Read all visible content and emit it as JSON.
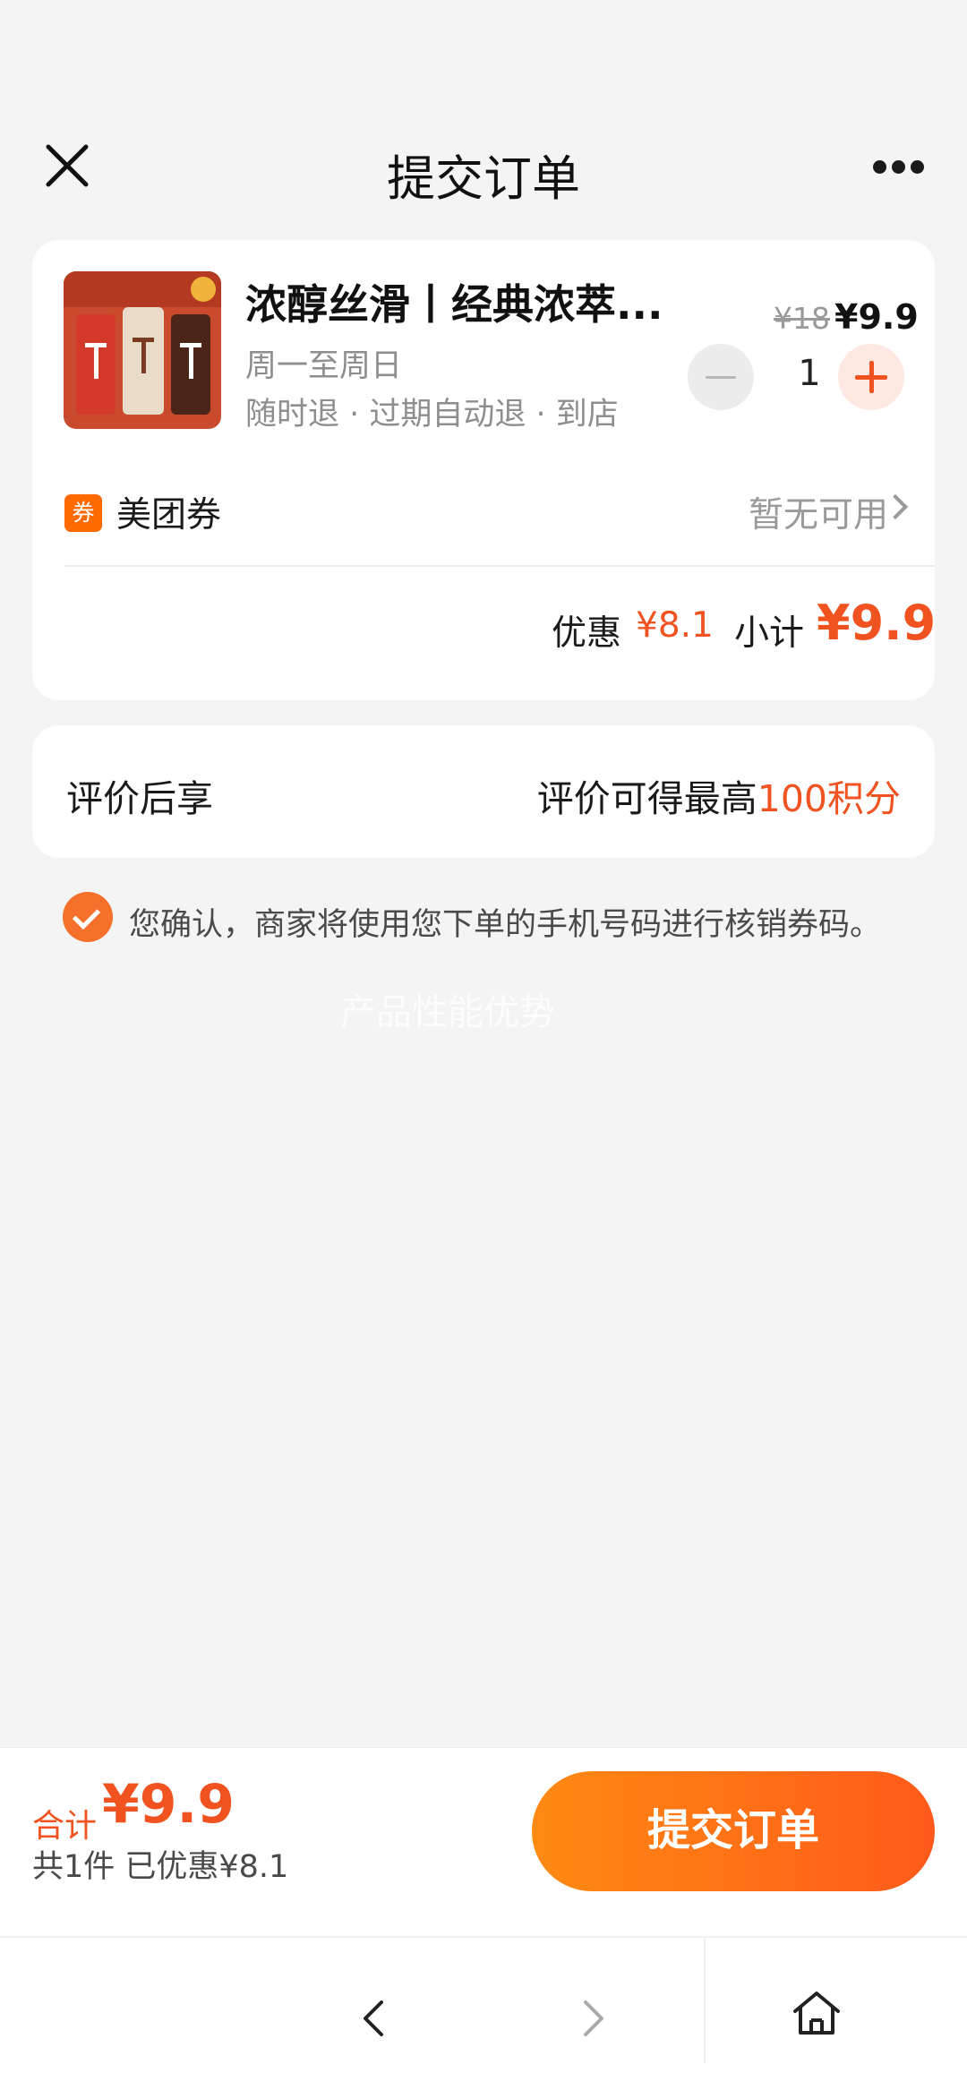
{
  "header": {
    "title": "提交订单"
  },
  "product": {
    "title": "浓醇丝滑丨经典浓萃...",
    "days": "周一至周日",
    "policy": "随时退 · 过期自动退 · 到店",
    "original_price": "¥18",
    "price": "¥9.9",
    "quantity": "1"
  },
  "coupon": {
    "icon_label": "券",
    "label": "美团券",
    "status": "暂无可用"
  },
  "summary": {
    "discount_label": "优惠",
    "discount_value": "¥8.1",
    "subtotal_label": "小计",
    "subtotal_value": "¥9.9"
  },
  "review": {
    "label": "评价后享",
    "note_prefix": "评价可得最高",
    "note_highlight": "100积分"
  },
  "confirm": {
    "text": "您确认，商家将使用您下单的手机号码进行核销券码。"
  },
  "watermark": "产品性能优势",
  "footer": {
    "total_label": "合计",
    "total_value": "¥9.9",
    "count_line": "共1件  已优惠¥8.1",
    "submit_label": "提交订单"
  },
  "colors": {
    "accent": "#f0531f",
    "button_gradient_start": "#ff8a12",
    "button_gradient_end": "#ff5a1a",
    "background": "#f4f4f4"
  },
  "icons": {
    "close": "close-icon",
    "more": "more-dots-icon",
    "back": "chevron-left-icon",
    "forward": "chevron-right-icon",
    "home": "home-icon"
  }
}
